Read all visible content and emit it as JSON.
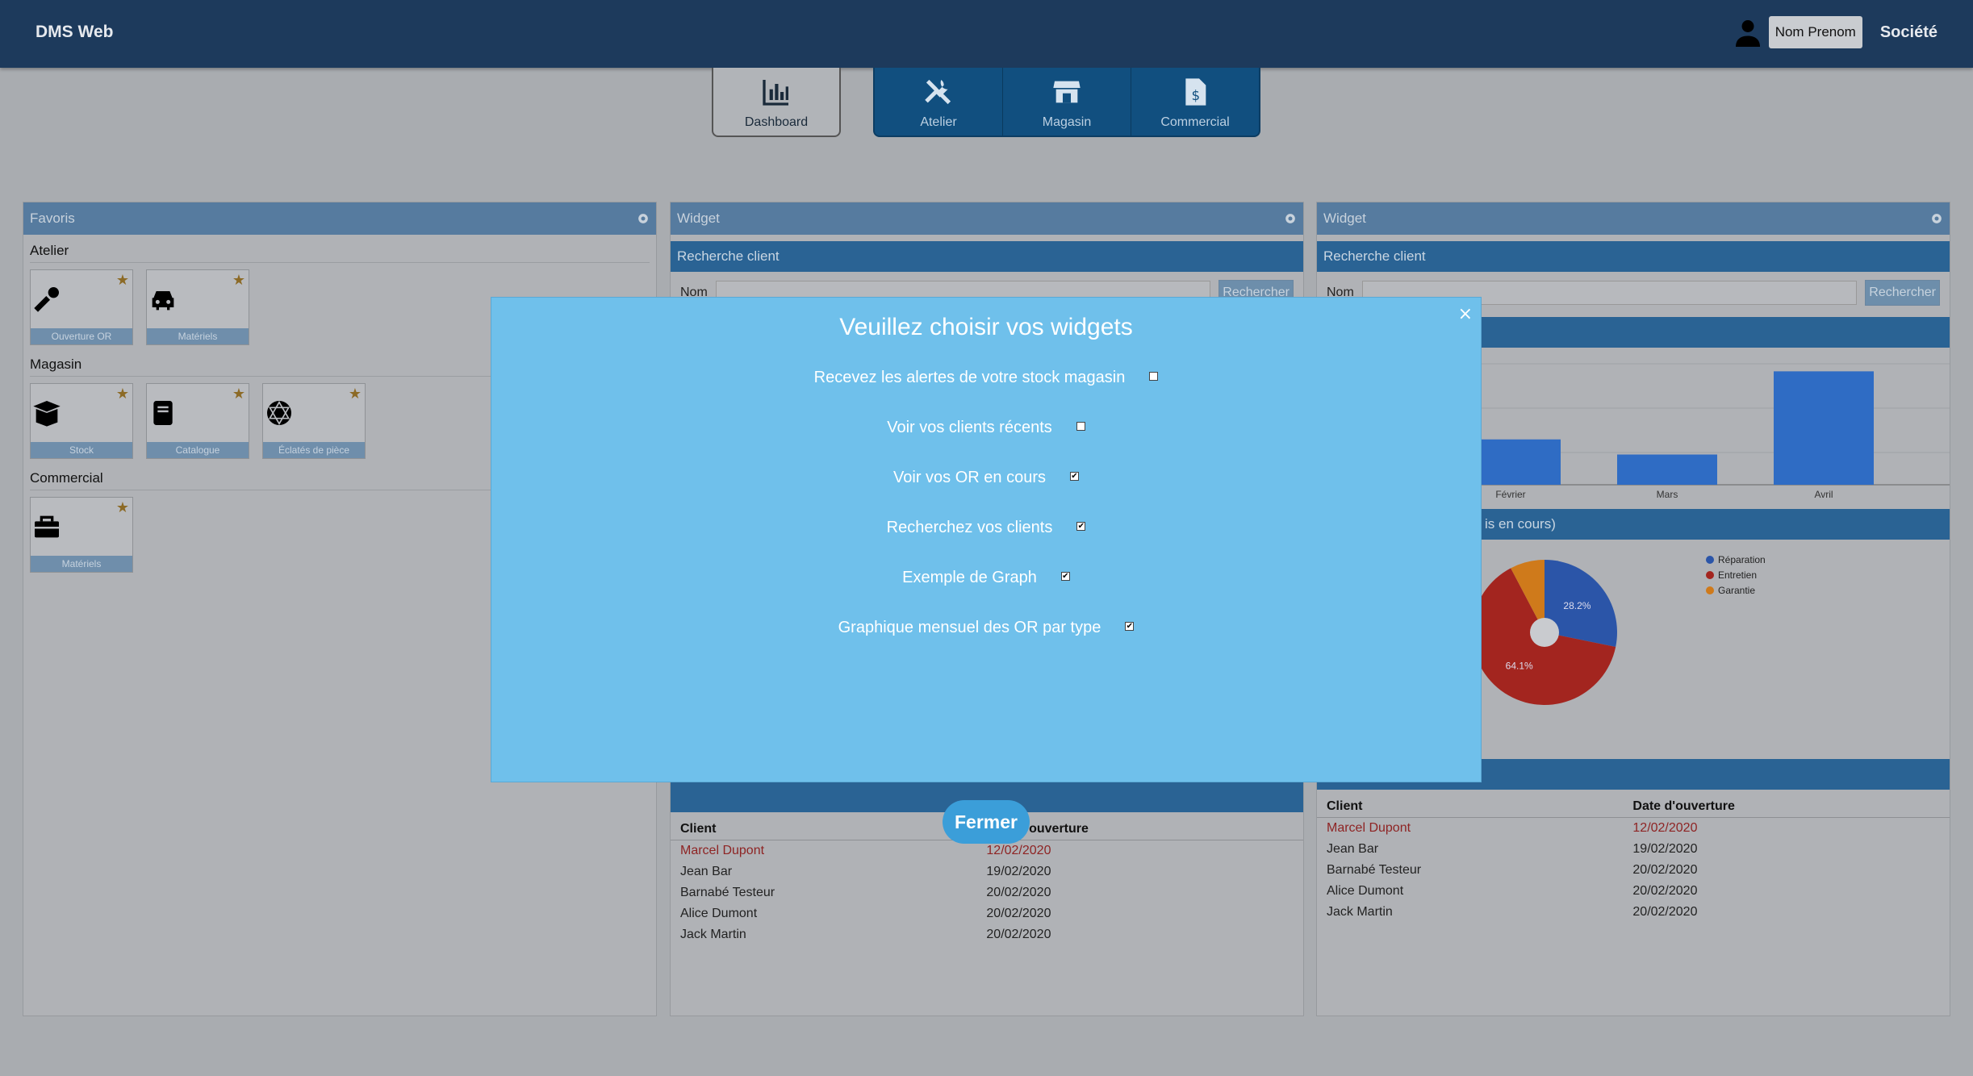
{
  "app": {
    "title": "DMS Web",
    "user_label": "Nom Prenom",
    "company": "Société"
  },
  "nav": {
    "dashboard": "Dashboard",
    "atelier": "Atelier",
    "magasin": "Magasin",
    "commercial": "Commercial"
  },
  "favoris": {
    "title": "Favoris",
    "sections": [
      {
        "title": "Atelier",
        "items": [
          {
            "label": "Ouverture OR",
            "icon": "wrench-icon"
          },
          {
            "label": "Matériels",
            "icon": "car-icon"
          }
        ]
      },
      {
        "title": "Magasin",
        "items": [
          {
            "label": "Stock",
            "icon": "box-icon"
          },
          {
            "label": "Catalogue",
            "icon": "book-icon"
          },
          {
            "label": "Éclatés de pièce",
            "icon": "atom-icon"
          }
        ]
      },
      {
        "title": "Commercial",
        "items": [
          {
            "label": "Matériels",
            "icon": "toolbox-icon"
          }
        ]
      }
    ]
  },
  "widget2": {
    "title": "Widget",
    "search_title": "Recherche client",
    "search_label": "Nom",
    "search_button": "Rechercher",
    "table_headers": [
      "Client",
      "Date d'ouverture"
    ],
    "rows": [
      [
        "Marcel Dupont",
        "12/02/2020"
      ],
      [
        "Jean Bar",
        "19/02/2020"
      ],
      [
        "Barnabé Testeur",
        "20/02/2020"
      ],
      [
        "Alice Dumont",
        "20/02/2020"
      ],
      [
        "Jack Martin",
        "20/02/2020"
      ]
    ]
  },
  "widget3": {
    "title": "Widget",
    "search_title": "Recherche client",
    "search_label": "Nom",
    "search_button": "Rechercher",
    "pie_title_fragment": "is en cours)",
    "table_headers": [
      "Client",
      "Date d'ouverture"
    ],
    "rows": [
      [
        "Marcel Dupont",
        "12/02/2020"
      ],
      [
        "Jean Bar",
        "19/02/2020"
      ],
      [
        "Barnabé Testeur",
        "20/02/2020"
      ],
      [
        "Alice Dumont",
        "20/02/2020"
      ],
      [
        "Jack Martin",
        "20/02/2020"
      ]
    ]
  },
  "chart_data": [
    {
      "type": "bar",
      "categories": [
        "Février",
        "Mars",
        "Avril"
      ],
      "values": [
        30,
        20,
        75
      ],
      "color": "#2f6cc4"
    },
    {
      "type": "pie",
      "labels": [
        "Réparation",
        "Entretien",
        "Garantie"
      ],
      "values": [
        28.2,
        64.1,
        7.7
      ],
      "value_labels": [
        "28.2%",
        "64.1%",
        ""
      ],
      "colors": [
        "#2b55a8",
        "#a3251f",
        "#cf7a1b"
      ]
    }
  ],
  "modal": {
    "title": "Veuillez choisir vos widgets",
    "close": "×",
    "options": [
      {
        "label": "Recevez les alertes de votre stock magasin",
        "checked": false
      },
      {
        "label": "Voir vos clients récents",
        "checked": false
      },
      {
        "label": "Voir vos OR en cours",
        "checked": true
      },
      {
        "label": "Recherchez vos clients",
        "checked": true
      },
      {
        "label": "Exemple de Graph",
        "checked": true
      },
      {
        "label": "Graphique mensuel des OR par type",
        "checked": true
      }
    ],
    "close_button": "Fermer"
  }
}
